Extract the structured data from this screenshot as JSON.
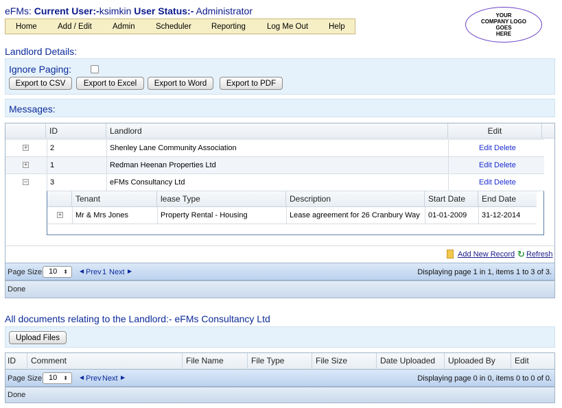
{
  "header": {
    "app_name": "eFMs:",
    "current_user_label": "Current User:-",
    "current_user": "ksimkin",
    "status_label": "User Status:-",
    "status_value": "Administrator"
  },
  "menu": [
    "Home",
    "Add / Edit",
    "Admin",
    "Scheduler",
    "Reporting",
    "Log Me Out",
    "Help"
  ],
  "logo_lines": [
    "YOUR",
    "COMPANY LOGO",
    "GOES",
    "HERE"
  ],
  "landlord_section": {
    "title": "Landlord Details:",
    "ignore_paging_label": "Ignore Paging:",
    "ignore_paging_checked": false,
    "export_buttons": [
      "Export to CSV",
      "Export to Excel",
      "Export to Word",
      "Export to PDF"
    ]
  },
  "messages_label": "Messages:",
  "grid": {
    "columns": [
      "ID",
      "Landlord",
      "Edit"
    ],
    "rows": [
      {
        "expander": "+",
        "id": "2",
        "landlord": "Shenley Lane Community Association",
        "edit": "Edit",
        "delete": "Delete"
      },
      {
        "expander": "+",
        "id": "1",
        "landlord": "Redman Heenan Properties Ltd",
        "edit": "Edit",
        "delete": "Delete"
      },
      {
        "expander": "−",
        "id": "3",
        "landlord": "eFMs Consultancy Ltd",
        "edit": "Edit",
        "delete": "Delete"
      }
    ],
    "detail": {
      "columns": [
        "Tenant",
        "lease Type",
        "Description",
        "Start Date",
        "End Date"
      ],
      "rows": [
        {
          "expander": "+",
          "tenant": "Mr & Mrs Jones",
          "lease_type": "Property Rental - Housing",
          "description": "Lease agreement for 26 Cranbury Way",
          "start": "01-01-2009",
          "end": "31-12-2014"
        }
      ]
    },
    "add_record": "Add New Record",
    "refresh": "Refresh",
    "pager": {
      "page_size_label": "Page Size:",
      "page_size": "10",
      "prev": "Prev",
      "page": "1",
      "next": "Next",
      "display": "Displaying page 1 in 1, items 1 to 3 of 3."
    },
    "status": "Done"
  },
  "documents": {
    "title": "All documents relating to the Landlord:- eFMs Consultancy Ltd",
    "upload_button": "Upload Files",
    "columns": [
      "ID",
      "Comment",
      "File Name",
      "File Type",
      "File Size",
      "Date Uploaded",
      "Uploaded By",
      "Edit"
    ],
    "pager": {
      "page_size_label": "Page Size:",
      "page_size": "10",
      "prev": "Prev",
      "next": "Next",
      "display": "Displaying page 0 in 0, items 0 to 0 of 0."
    },
    "status": "Done"
  },
  "colors": {
    "title_blue": "#0b2a9b",
    "link_blue": "#1b2bd0",
    "menu_bg": "#f6efc6",
    "panel_bg": "#e6f2fb",
    "logo_border": "#6a3fc8"
  }
}
